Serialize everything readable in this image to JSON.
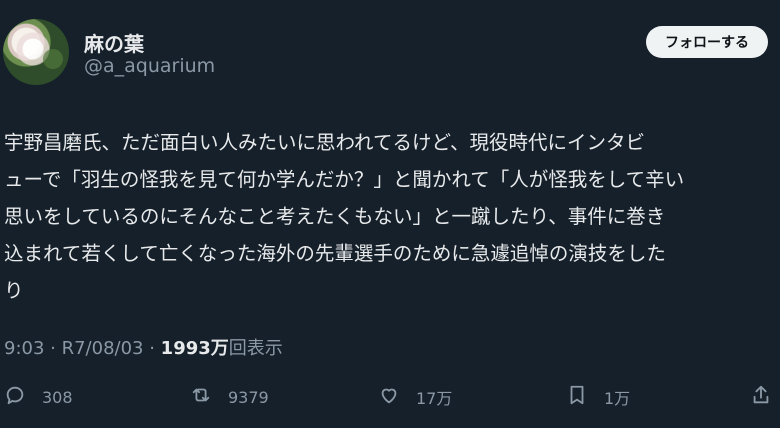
{
  "user": {
    "name": "麻の葉",
    "handle": "@a_aquarium",
    "follow_label": "フォローする"
  },
  "tweet": {
    "lines": [
      "宇野昌磨氏、ただ面白い人みたいに思われてるけど、現役時代にインタビ",
      "ューで「羽生の怪我を見て何か学んだか？」と聞かれて「人が怪我をして辛い",
      "思いをしているのにそんなこと考えたくもない」と一蹴したり、事件に巻き",
      "込まれて若くして亡くなった海外の先輩選手のために急遽追悼の演技をした",
      "り"
    ],
    "time": "9:03",
    "separator1": " · ",
    "date": "R7/08/03",
    "separator2": " · ",
    "views": "1993万",
    "views_label": "回表示"
  },
  "actions": {
    "reply": {
      "icon": "reply-icon",
      "count": "308"
    },
    "retweet": {
      "icon": "retweet-icon",
      "count": "9379"
    },
    "like": {
      "icon": "heart-icon",
      "count": "17万"
    },
    "bookmark": {
      "icon": "bookmark-icon",
      "count": "1万"
    },
    "share": {
      "icon": "share-icon"
    }
  }
}
